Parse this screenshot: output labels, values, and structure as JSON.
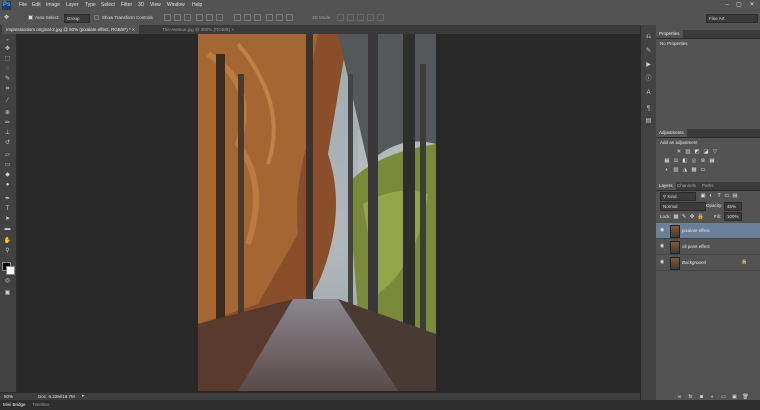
{
  "app": {
    "logo": "Ps"
  },
  "menu": [
    "File",
    "Edit",
    "Image",
    "Layer",
    "Type",
    "Select",
    "Filter",
    "3D",
    "View",
    "Window",
    "Help"
  ],
  "window_controls": {
    "minimize": "–",
    "maximize": "▢",
    "close": "✕"
  },
  "options": {
    "auto_select_label": "Auto-Select:",
    "auto_select_value": "Group",
    "show_transform_label": "Show Transform Controls",
    "mode_3d_label": "3D Mode:",
    "workspace": "Fine Art"
  },
  "tabs": [
    {
      "label": "Impressionism original-2.jpg @ 50% (pixalate effect, RGB/8*) *",
      "active": true
    },
    {
      "label": "The-Avenue.jpg @ 200% (RGB/8)",
      "active": false
    }
  ],
  "status": {
    "zoom": "50%",
    "doc": "Doc: 6.22M/18.7M"
  },
  "bottom_tabs": [
    "Mini Bridge",
    "Timeline"
  ],
  "properties": {
    "title": "Properties",
    "message": "No Properties"
  },
  "adjustments": {
    "title": "Adjustments",
    "hint": "Add an adjustment"
  },
  "layers_panel": {
    "tabs": [
      "Layers",
      "Channels",
      "Paths"
    ],
    "kind_label": "Kind",
    "blend_mode": "Normal",
    "opacity_label": "Opacity:",
    "opacity_value": "45%",
    "lock_label": "Lock:",
    "fill_label": "Fill:",
    "fill_value": "100%",
    "layers": [
      {
        "name": "pixalate effect",
        "selected": true
      },
      {
        "name": "oil paint  effect",
        "selected": false
      },
      {
        "name": "Background",
        "selected": false,
        "locked": true
      }
    ]
  }
}
